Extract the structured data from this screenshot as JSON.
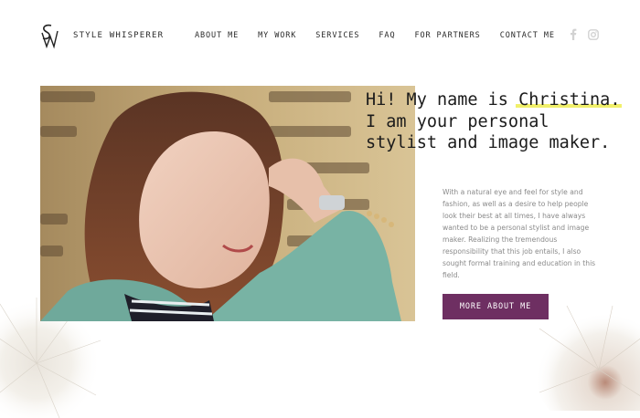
{
  "header": {
    "brand": "STYLE WHISPERER",
    "logo_icon": "sw-monogram-logo",
    "nav": [
      {
        "label": "ABOUT ME"
      },
      {
        "label": "MY WORK"
      },
      {
        "label": "SERVICES"
      },
      {
        "label": "FAQ"
      },
      {
        "label": "FOR PARTNERS"
      },
      {
        "label": "CONTACT ME"
      }
    ],
    "social": [
      {
        "icon": "facebook-icon"
      },
      {
        "icon": "instagram-icon"
      }
    ]
  },
  "hero": {
    "photo": "smiling woman with long auburn hair in teal blazer",
    "headline_pre": "Hi! My name is ",
    "headline_name": "Christina.",
    "headline_post": " I am your personal stylist and image maker.",
    "body": "With a natural eye and feel for style and fashion, as well as a desire to help people look their best at all times, I have always wanted to be a personal stylist and image maker. Realizing the tremendous responsibility that this job entails, I also sought formal training and education in this field.",
    "cta_label": "MORE ABOUT ME"
  },
  "colors": {
    "accent": "#6e2f62",
    "highlight": "#f1f06a",
    "text": "#1b1b1b",
    "muted": "#8a8a8a"
  }
}
